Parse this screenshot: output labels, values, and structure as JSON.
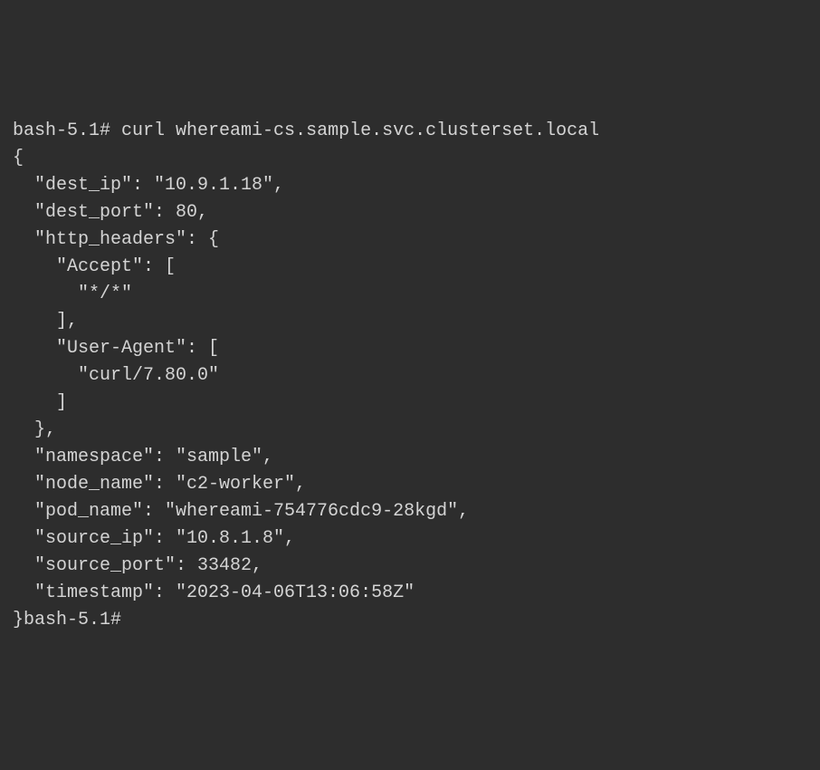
{
  "prompt1": "bash-5.1# ",
  "command": "curl whereami-cs.sample.svc.clusterset.local",
  "output_lines": [
    "{",
    "  \"dest_ip\": \"10.9.1.18\",",
    "  \"dest_port\": 80,",
    "  \"http_headers\": {",
    "    \"Accept\": [",
    "      \"*/*\"",
    "    ],",
    "    \"User-Agent\": [",
    "      \"curl/7.80.0\"",
    "    ]",
    "  },",
    "  \"namespace\": \"sample\",",
    "  \"node_name\": \"c2-worker\",",
    "  \"pod_name\": \"whereami-754776cdc9-28kgd\",",
    "  \"source_ip\": \"10.8.1.8\",",
    "  \"source_port\": 33482,",
    "  \"timestamp\": \"2023-04-06T13:06:58Z\""
  ],
  "last_line_close": "}",
  "prompt2": "bash-5.1# "
}
